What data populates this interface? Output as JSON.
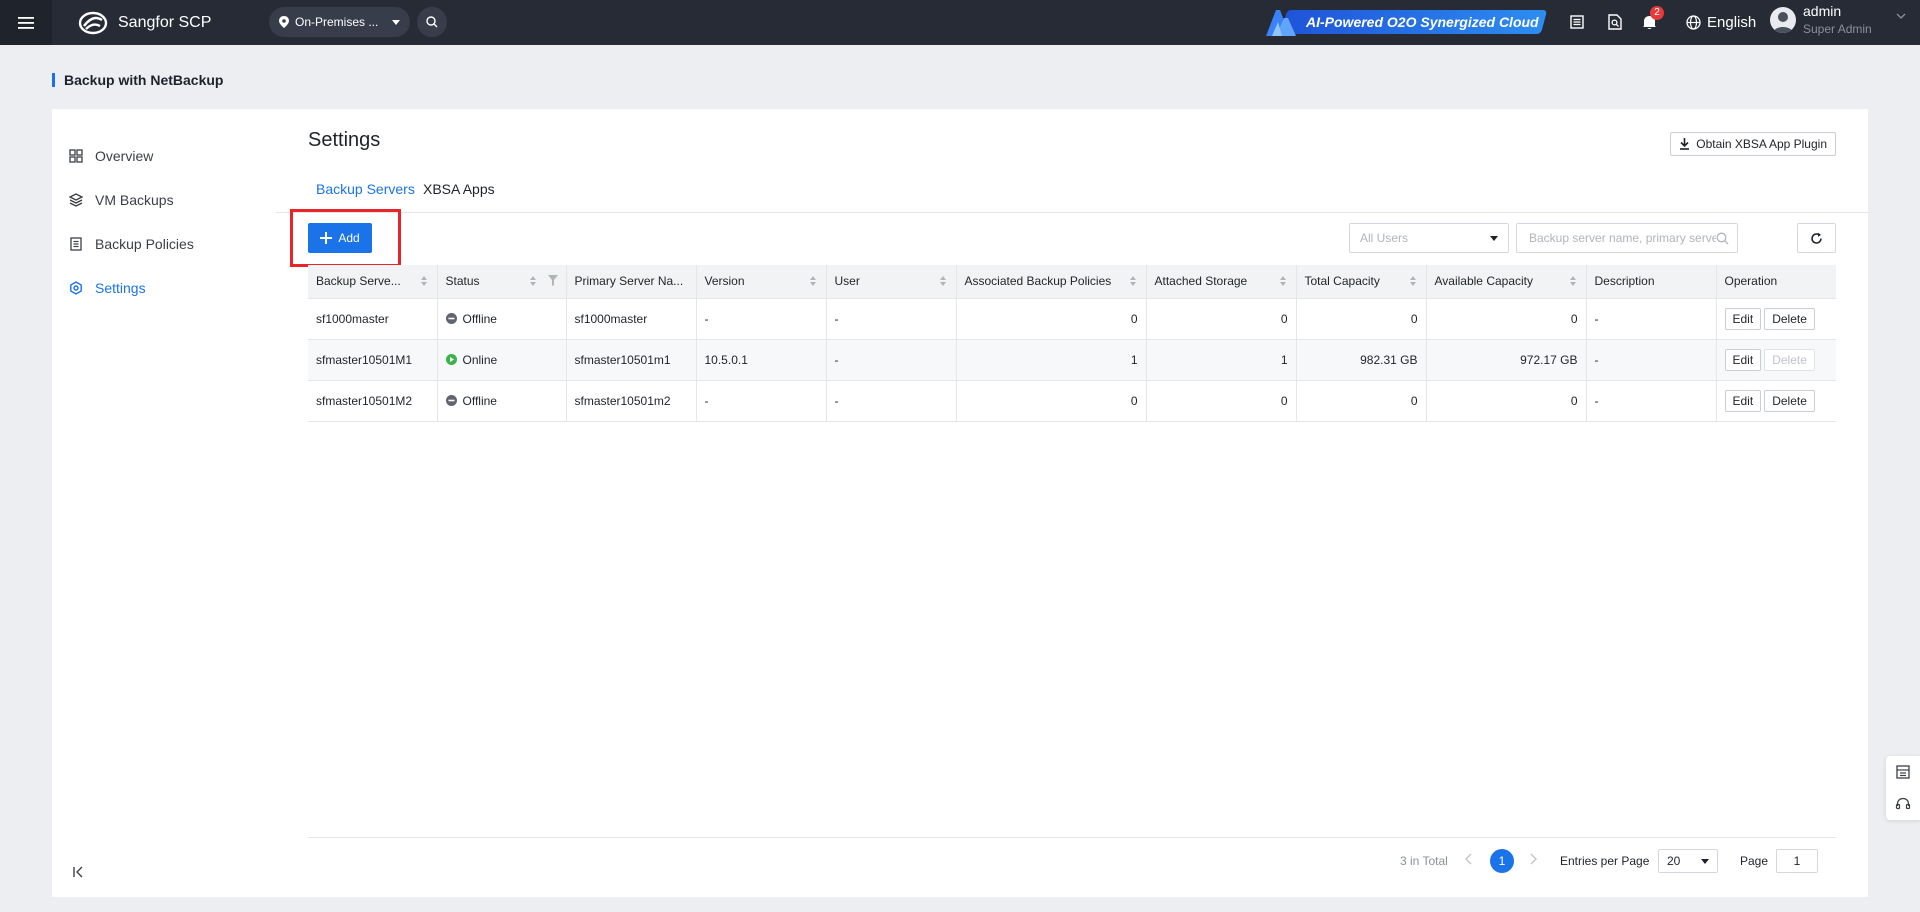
{
  "topbar": {
    "brand": "Sangfor SCP",
    "location": "On-Premises ...",
    "promo": "AI-Powered O2O Synergized Cloud",
    "notification_count": "2",
    "language": "English",
    "user_name": "admin",
    "user_role": "Super Admin"
  },
  "page": {
    "title": "Backup with NetBackup"
  },
  "nav": {
    "items": [
      {
        "label": "Overview",
        "icon": "grid-icon"
      },
      {
        "label": "VM Backups",
        "icon": "layers-icon"
      },
      {
        "label": "Backup Policies",
        "icon": "document-icon"
      },
      {
        "label": "Settings",
        "icon": "settings-icon",
        "active": true
      }
    ]
  },
  "main": {
    "title": "Settings",
    "obtain_button": "Obtain XBSA App Plugin",
    "tabs": [
      {
        "label": "Backup Servers",
        "active": true
      },
      {
        "label": "XBSA Apps",
        "active": false
      }
    ],
    "add_button": "Add",
    "user_filter_placeholder": "All Users",
    "search_placeholder": "Backup server name, primary server name"
  },
  "table": {
    "columns": [
      "Backup Serve...",
      "Status",
      "Primary Server Na...",
      "Version",
      "User",
      "Associated Backup Policies",
      "Attached Storage",
      "Total Capacity",
      "Available Capacity",
      "Description",
      "Operation"
    ],
    "rows": [
      {
        "name": "sf1000master",
        "status": "Offline",
        "primary": "sf1000master",
        "version": "-",
        "user": "-",
        "policies": "0",
        "storage": "0",
        "total": "0",
        "available": "0",
        "description": "-",
        "edit": "Edit",
        "delete": "Delete"
      },
      {
        "name": "sfmaster10501M1",
        "status": "Online",
        "primary": "sfmaster10501m1",
        "version": "10.5.0.1",
        "user": "-",
        "policies": "1",
        "storage": "1",
        "total": "982.31 GB",
        "available": "972.17 GB",
        "description": "-",
        "edit": "Edit",
        "delete": "Delete"
      },
      {
        "name": "sfmaster10501M2",
        "status": "Offline",
        "primary": "sfmaster10501m2",
        "version": "-",
        "user": "-",
        "policies": "0",
        "storage": "0",
        "total": "0",
        "available": "0",
        "description": "-",
        "edit": "Edit",
        "delete": "Delete"
      }
    ]
  },
  "pagination": {
    "total": "3 in Total",
    "current_page": "1",
    "entries_label": "Entries per Page",
    "page_size": "20",
    "page_label": "Page",
    "page_input": "1"
  },
  "colors": {
    "accent": "#1a73e8",
    "online": "#3cb34a",
    "offline": "#5f6470",
    "highlight": "#e8262a"
  }
}
